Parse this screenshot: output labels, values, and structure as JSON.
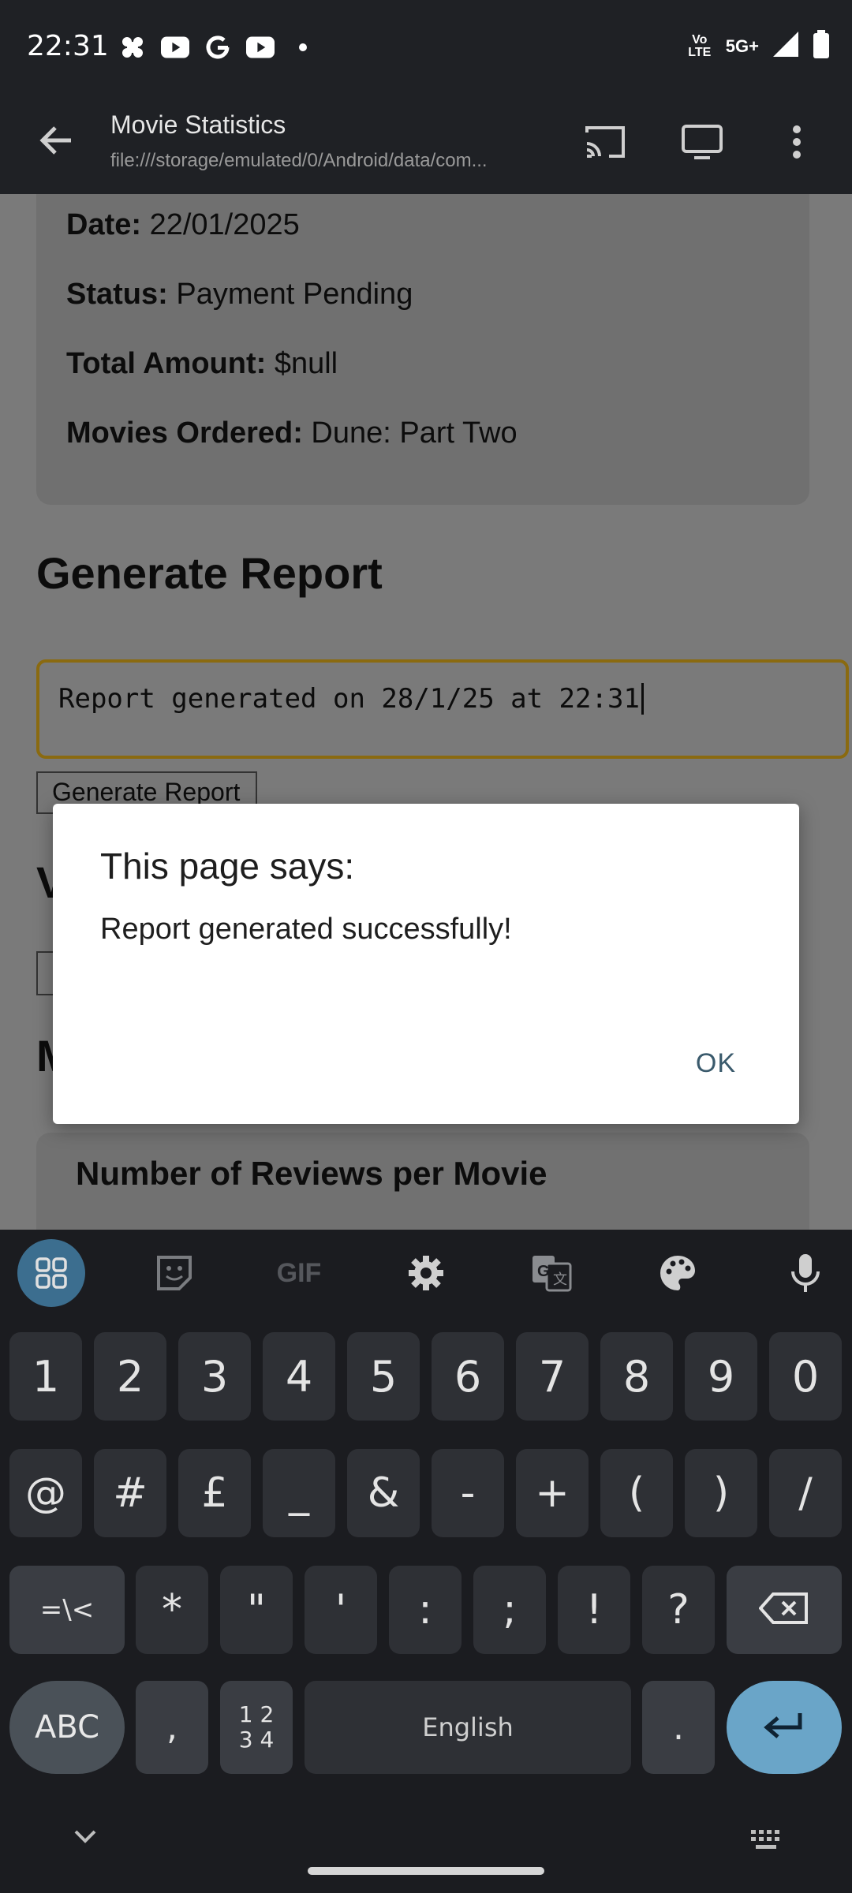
{
  "status_bar": {
    "time": "22:31",
    "left_icons": [
      "pinwheel-icon",
      "youtube-icon",
      "google-icon",
      "youtube-icon",
      "dot-icon"
    ],
    "network_volte": "Vo LTE",
    "network_type": "5G+",
    "signal_icon": "signal-icon",
    "battery_icon": "battery-icon"
  },
  "app_bar": {
    "title": "Movie Statistics",
    "url": "file:///storage/emulated/0/Android/data/com...",
    "actions": [
      "cast-icon",
      "desktop-icon",
      "more-vert-icon"
    ]
  },
  "order_card": {
    "date_label": "Date:",
    "date_value": " 22/01/2025",
    "status_label": "Status:",
    "status_value": " Payment Pending",
    "total_label": "Total Amount:",
    "total_value": " $null",
    "movies_label": "Movies Ordered:",
    "movies_value": " Dune: Part Two"
  },
  "report_section": {
    "heading": "Generate Report",
    "input_value": "Report generated on 28/1/25 at 22:31",
    "button_label": "Generate Report"
  },
  "obscured": {
    "heading_w": "V",
    "heading_m": "M",
    "card_title": "Number of Reviews per Movie"
  },
  "dialog": {
    "title": "This page says:",
    "message": "Report generated successfully!",
    "ok_label": "OK"
  },
  "keyboard": {
    "toolbar_icons": [
      "apps-grid-icon",
      "sticker-icon",
      "gif-icon",
      "settings-icon",
      "translate-icon",
      "palette-icon",
      "mic-icon"
    ],
    "gif_label": "GIF",
    "row1": [
      "1",
      "2",
      "3",
      "4",
      "5",
      "6",
      "7",
      "8",
      "9",
      "0"
    ],
    "row2": [
      "@",
      "#",
      "£",
      "_",
      "&",
      "-",
      "+",
      "(",
      ")",
      "/"
    ],
    "row3": [
      "=\\<",
      "*",
      "\"",
      "'",
      ":",
      ";",
      "!",
      "?"
    ],
    "abc": "ABC",
    "comma": ",",
    "numpad": "1 2\n3 4",
    "space": "English",
    "period": ".",
    "enter_icon": "enter-icon",
    "backspace_icon": "backspace-icon"
  }
}
